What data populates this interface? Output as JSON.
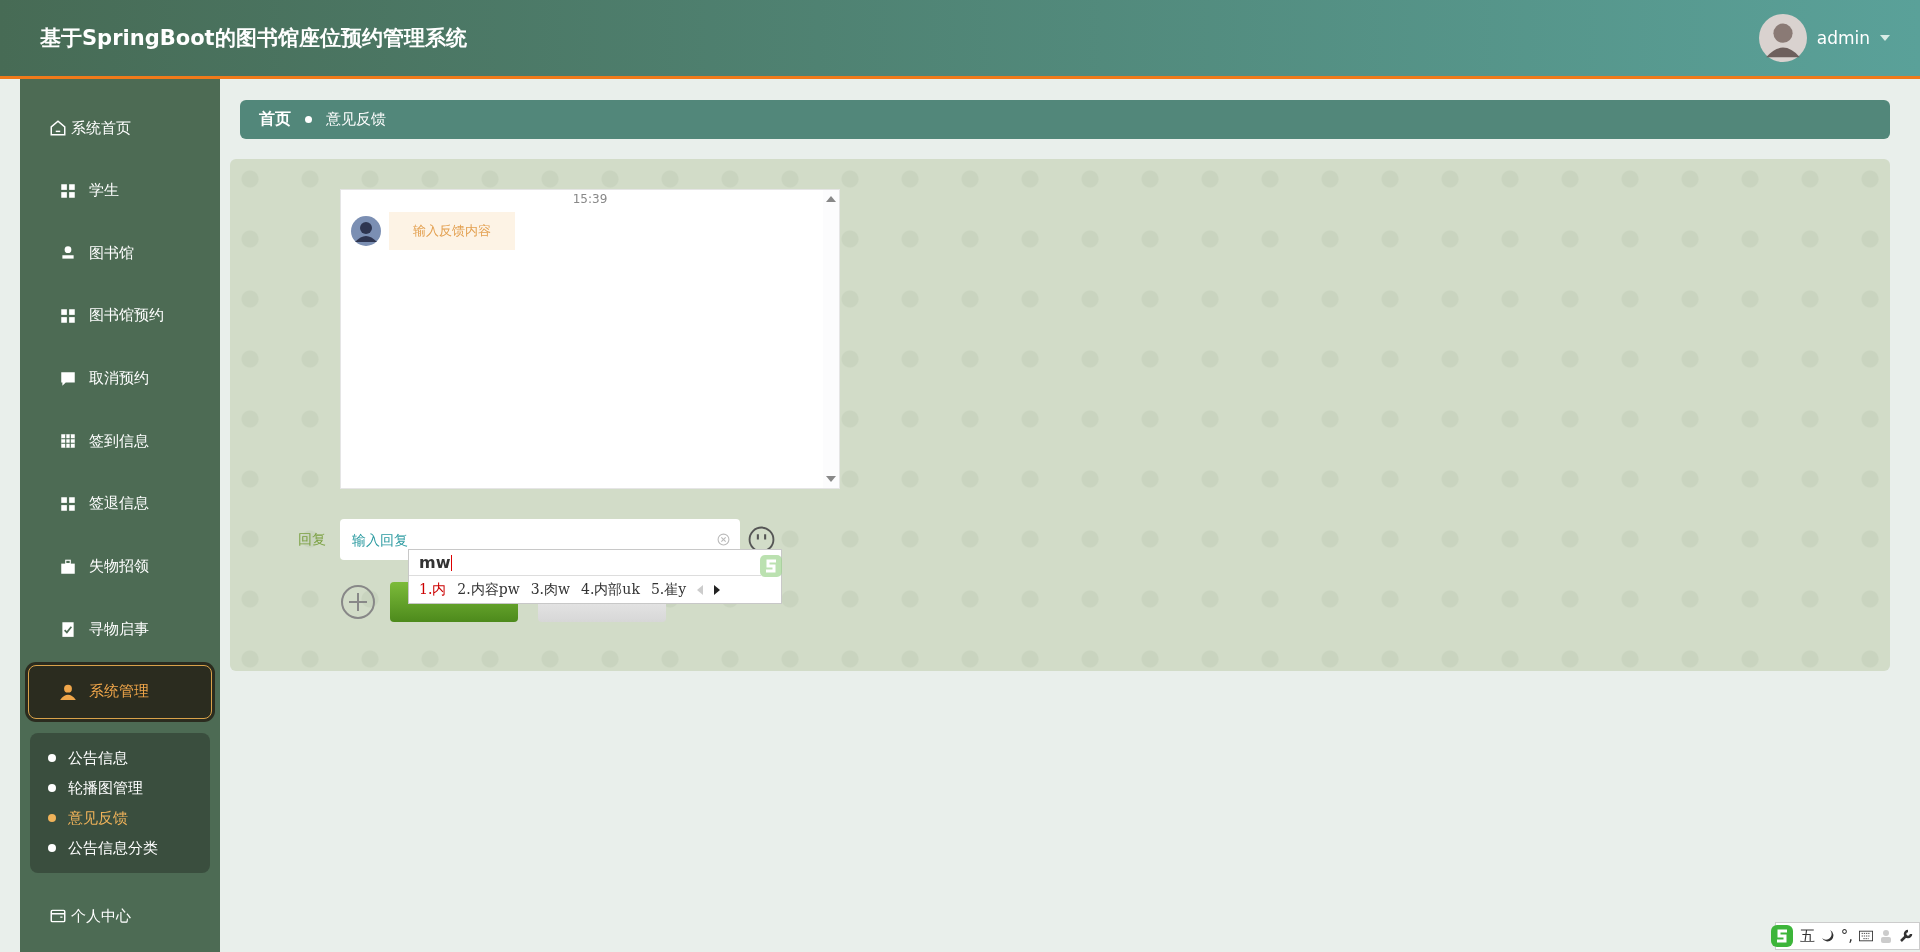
{
  "header": {
    "title": "基于SpringBoot的图书馆座位预约管理系统",
    "user": "admin"
  },
  "sidebar": {
    "items": [
      {
        "label": "系统首页",
        "kind": "home",
        "selected": false
      },
      {
        "label": "学生",
        "kind": "grid",
        "selected": false
      },
      {
        "label": "图书馆",
        "kind": "person",
        "selected": false
      },
      {
        "label": "图书馆预约",
        "kind": "grid",
        "selected": false
      },
      {
        "label": "取消预约",
        "kind": "chat",
        "selected": false
      },
      {
        "label": "签到信息",
        "kind": "table",
        "selected": false
      },
      {
        "label": "签退信息",
        "kind": "grid",
        "selected": false
      },
      {
        "label": "失物招领",
        "kind": "case",
        "selected": false
      },
      {
        "label": "寻物启事",
        "kind": "clipboard",
        "selected": false
      },
      {
        "label": "系统管理",
        "kind": "user",
        "selected": true,
        "children": [
          {
            "label": "公告信息",
            "selected": false
          },
          {
            "label": "轮播图管理",
            "selected": false
          },
          {
            "label": "意见反馈",
            "selected": true
          },
          {
            "label": "公告信息分类",
            "selected": false
          }
        ]
      },
      {
        "label": "个人中心",
        "kind": "wallet",
        "selected": false
      }
    ]
  },
  "breadcrumb": [
    "首页",
    "意见反馈"
  ],
  "chat": {
    "time": "15:39",
    "messages": [
      "输入反馈内容"
    ]
  },
  "reply": {
    "label": "回复",
    "placeholder": "输入回复"
  },
  "ime": {
    "input": "mw",
    "candidates": [
      {
        "label": "1.内",
        "selected": true
      },
      {
        "label": "2.内容pw",
        "selected": false
      },
      {
        "label": "3.肉w",
        "selected": false
      },
      {
        "label": "4.内部uk",
        "selected": false
      },
      {
        "label": "5.崔y",
        "selected": false
      }
    ]
  },
  "ime_toolbar": {
    "mode": "五",
    "punct": "°,"
  }
}
